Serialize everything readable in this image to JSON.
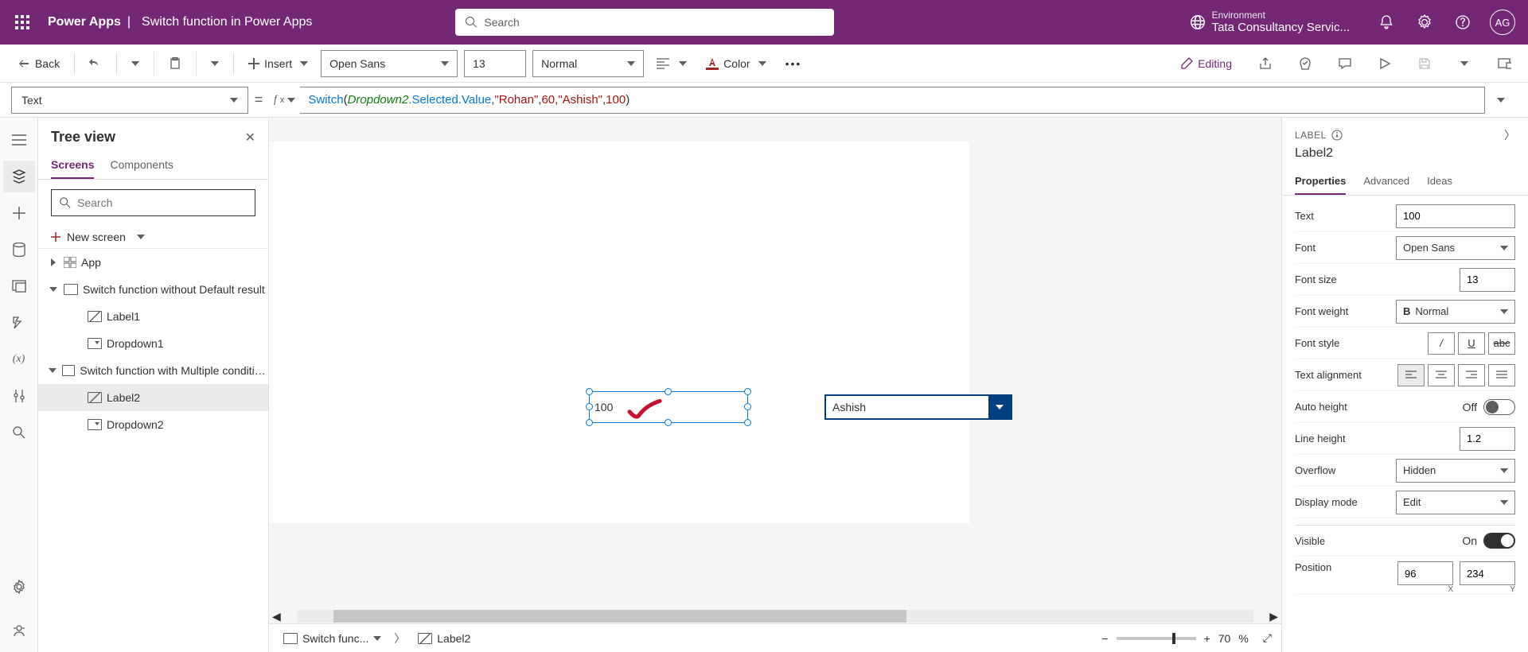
{
  "header": {
    "app_name": "Power Apps",
    "separator": "|",
    "file_name": "Switch function in Power Apps",
    "search_placeholder": "Search",
    "env_label": "Environment",
    "env_value": "Tata Consultancy Servic...",
    "avatar": "AG"
  },
  "toolbar": {
    "back": "Back",
    "insert": "Insert",
    "font_name": "Open Sans",
    "font_size": "13",
    "font_weight": "Normal",
    "color": "Color",
    "editing": "Editing"
  },
  "formula_bar": {
    "property": "Text",
    "fn": "Switch",
    "id": "Dropdown2",
    "chain": ".Selected.Value",
    "arg1": "\"Rohan\"",
    "arg2": "60",
    "arg3": "\"Ashish\"",
    "arg4": "100"
  },
  "tree": {
    "title": "Tree view",
    "tab_screens": "Screens",
    "tab_components": "Components",
    "search_placeholder": "Search",
    "new_screen": "New screen",
    "items": [
      {
        "label": "App"
      },
      {
        "label": "Switch function without Default result"
      },
      {
        "label": "Label1"
      },
      {
        "label": "Dropdown1"
      },
      {
        "label": "Switch function with Multiple conditions and"
      },
      {
        "label": "Label2"
      },
      {
        "label": "Dropdown2"
      }
    ]
  },
  "canvas": {
    "selected_text": "100",
    "dropdown_value": "Ashish"
  },
  "breadcrumb": {
    "screen": "Switch func...",
    "control": "Label2",
    "zoom": "70",
    "zoom_unit": "%"
  },
  "properties": {
    "type": "LABEL",
    "name": "Label2",
    "tab_properties": "Properties",
    "tab_advanced": "Advanced",
    "tab_ideas": "Ideas",
    "rows": {
      "text_label": "Text",
      "text_value": "100",
      "font_label": "Font",
      "font_value": "Open Sans",
      "fontsize_label": "Font size",
      "fontsize_value": "13",
      "fontweight_label": "Font weight",
      "fontweight_value": "Normal",
      "fontstyle_label": "Font style",
      "align_label": "Text alignment",
      "autoheight_label": "Auto height",
      "autoheight_value": "Off",
      "lineheight_label": "Line height",
      "lineheight_value": "1.2",
      "overflow_label": "Overflow",
      "overflow_value": "Hidden",
      "display_label": "Display mode",
      "display_value": "Edit",
      "visible_label": "Visible",
      "visible_value": "On",
      "position_label": "Position",
      "pos_x": "96",
      "pos_y": "234",
      "pos_x_label": "X",
      "pos_y_label": "Y"
    }
  }
}
